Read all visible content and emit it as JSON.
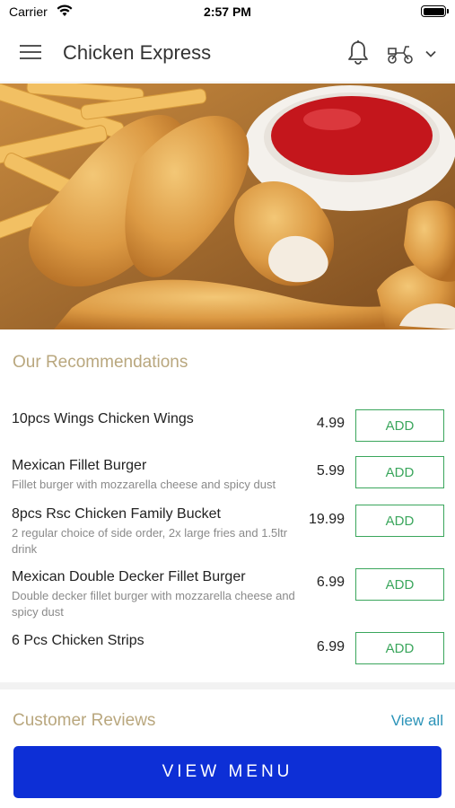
{
  "status_bar": {
    "carrier": "Carrier",
    "time": "2:57 PM"
  },
  "header": {
    "title": "Chicken Express"
  },
  "icons": {
    "menu": "hamburger-menu-icon",
    "notifications": "bell-icon",
    "delivery": "scooter-icon",
    "dropdown": "chevron-down-icon"
  },
  "recommendations": {
    "title": "Our Recommendations",
    "items": [
      {
        "name": "10pcs Wings Chicken Wings",
        "description": "",
        "price": "4.99",
        "add_label": "ADD"
      },
      {
        "name": "Mexican Fillet Burger",
        "description": "Fillet burger with mozzarella cheese and spicy dust",
        "price": "5.99",
        "add_label": "ADD"
      },
      {
        "name": "8pcs Rsc Chicken Family Bucket",
        "description": "2 regular choice of side order, 2x large fries and 1.5ltr drink",
        "price": "19.99",
        "add_label": "ADD"
      },
      {
        "name": "Mexican Double Decker Fillet Burger",
        "description": "Double decker fillet burger with mozzarella cheese and spicy dust",
        "price": "6.99",
        "add_label": "ADD"
      },
      {
        "name": "6 Pcs Chicken Strips",
        "description": "",
        "price": "6.99",
        "add_label": "ADD"
      }
    ]
  },
  "reviews": {
    "title": "Customer Reviews",
    "view_all_label": "View all"
  },
  "cta": {
    "label": "VIEW MENU"
  },
  "colors": {
    "accent_gold": "#b9a77e",
    "add_green": "#3aa65c",
    "link_blue": "#2a93b8",
    "cta_blue": "#0d2fd6"
  }
}
